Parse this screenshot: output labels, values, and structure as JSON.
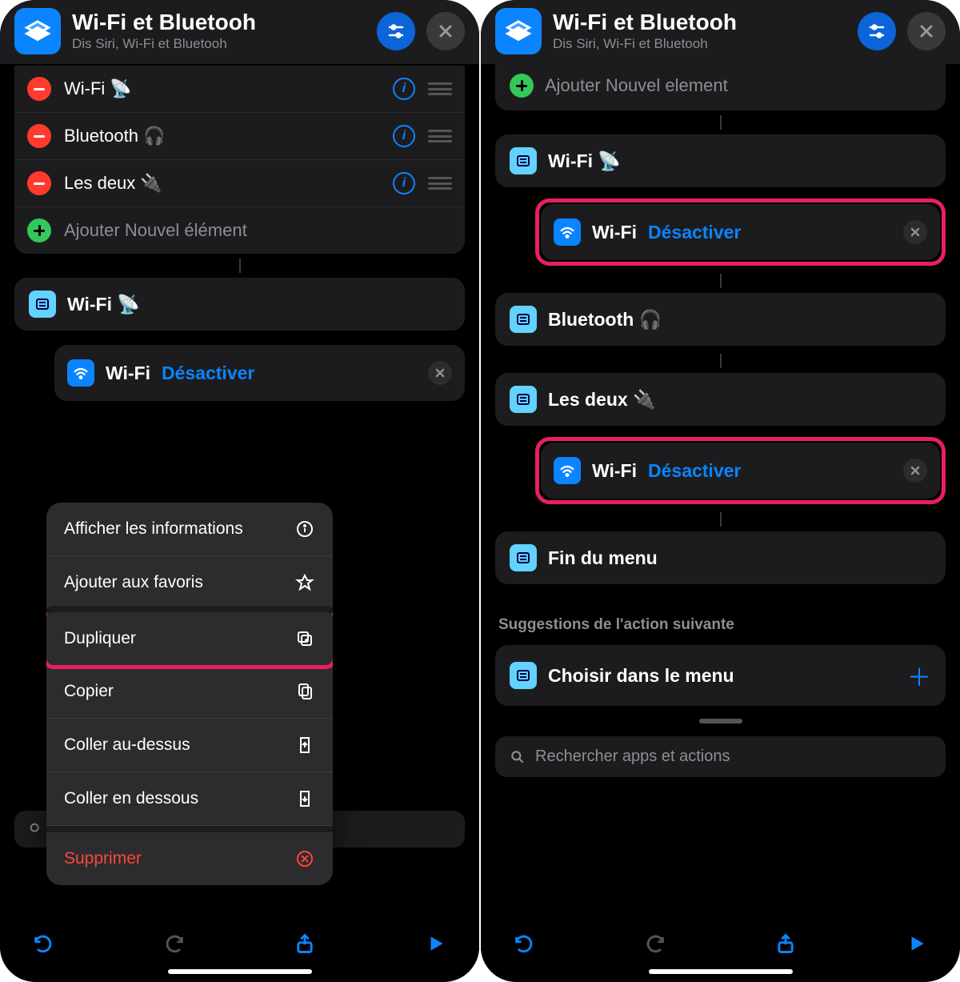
{
  "header": {
    "title": "Wi-Fi et Bluetooh",
    "subtitle": "Dis Siri, Wi-Fi et Bluetooh"
  },
  "left": {
    "menu_items": [
      {
        "label": "Wi-Fi 📡"
      },
      {
        "label": "Bluetooth 🎧"
      },
      {
        "label": "Les deux 🔌"
      }
    ],
    "add_item": "Ajouter Nouvel élément",
    "section_wifi": "Wi-Fi 📡",
    "action_wifi": "Wi-Fi",
    "action_state": "Désactiver",
    "context": {
      "info": "Afficher les informations",
      "favorite": "Ajouter aux favoris",
      "duplicate": "Dupliquer",
      "copy": "Copier",
      "paste_above": "Coller au-dessus",
      "paste_below": "Coller en dessous",
      "delete": "Supprimer"
    }
  },
  "right": {
    "add_item_peek": "Ajouter Nouvel element",
    "section_wifi": "Wi-Fi 📡",
    "action_wifi": "Wi-Fi",
    "action_state": "Désactiver",
    "section_bt": "Bluetooth 🎧",
    "section_both": "Les deux 🔌",
    "section_end": "Fin du menu",
    "suggestions_label": "Suggestions de l'action suivante",
    "suggestion_choose": "Choisir dans le menu",
    "search_placeholder": "Rechercher apps et actions"
  }
}
